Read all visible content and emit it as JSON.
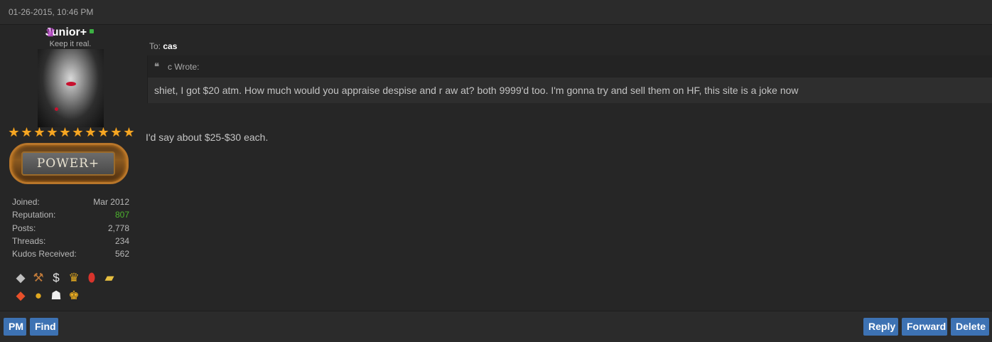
{
  "post": {
    "date": "01-26-2015, 10:46 PM",
    "to_label": "To:",
    "to_user": "cas",
    "quote_author": "c Wrote:",
    "quote_text": "shiet, I got $20 atm. How much would you appraise despise and r aw at? both 9999'd too. I'm gonna try and sell them on HF, this site is a joke now",
    "reply_text": "I'd say about $25-$30 each."
  },
  "author": {
    "username": "Junior+",
    "usertitle": "Keep it real.",
    "stars": 10,
    "badge_label": "POWER+",
    "stats": [
      {
        "label": "Joined:",
        "value": "Mar 2012"
      },
      {
        "label": "Reputation:",
        "value": "807"
      },
      {
        "label": "Posts:",
        "value": "2,778"
      },
      {
        "label": "Threads:",
        "value": "234"
      },
      {
        "label": "Kudos Received:",
        "value": "562"
      }
    ],
    "awards_row1": [
      "diamond-icon",
      "hammer-icon",
      "money-bag-icon",
      "trophy-icon",
      "pill-icon",
      "gold-bar-icon"
    ],
    "awards_row2": [
      "red-diamond-icon",
      "gold-medal-icon",
      "stormtrooper-icon",
      "crown-k-icon"
    ]
  },
  "buttons": {
    "pm": "PM",
    "find": "Find",
    "reply": "Reply",
    "forward": "Forward",
    "delete": "Delete"
  },
  "colors": {
    "background": "#262626",
    "bar": "#2b2b2b",
    "button": "#3d72b3",
    "reputation": "#4db32e",
    "star": "#f5a623"
  }
}
